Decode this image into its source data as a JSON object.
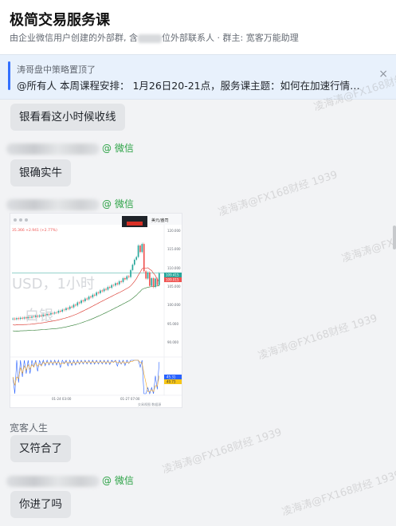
{
  "header": {
    "title": "极简交易服务课",
    "subtitle_prefix": "由企业微信用户创建的外部群, 含",
    "subtitle_suffix": "位外部联系人 · 群主: 宽客万能助理"
  },
  "pinned": {
    "title": "涛哥盘中策略置顶了",
    "content": "@所有人 本周课程安排： 1月26日20-21点，服务课主题：如何在加速行情中收...",
    "close": "×"
  },
  "messages": [
    {
      "text": "银看看这小时候收线"
    },
    {
      "sender_tag": "@ 微信",
      "text": "银确实牛"
    },
    {
      "sender_tag": "@ 微信"
    },
    {
      "sender": "宽客人生",
      "text": "又符合了"
    },
    {
      "sender_tag": "@ 微信",
      "text": "你进了吗"
    }
  ],
  "chart": {
    "price_change": "35.366 +2.941 (+2.77%)",
    "symbol_ghost": "USD，1小时",
    "name_ghost": "白银",
    "right_badge": "美元/盎司",
    "y_ticks": [
      "120.000",
      "115.000",
      "110.000",
      "105.000",
      "100.000",
      "95.000",
      "90.000"
    ],
    "last_price": "109.415",
    "last_price_sub": "109.015",
    "x_ticks": [
      "01-24 03:00",
      "01-27 07:00"
    ],
    "osc_labels": [
      "45.31",
      "49.73"
    ],
    "footer": "交易视图 数据源"
  },
  "chart_data": {
    "type": "line",
    "title": "",
    "close": [
      97.6,
      97.4,
      97.7,
      97.5,
      97.8,
      97.6,
      97.9,
      97.7,
      98.0,
      97.8,
      98.1,
      98.0,
      98.3,
      98.1,
      98.4,
      98.3,
      98.6,
      98.5,
      98.8,
      98.7,
      99.0,
      98.9,
      99.2,
      99.1,
      99.6,
      99.4,
      99.9,
      99.8,
      100.3,
      100.1,
      100.7,
      100.5,
      101.2,
      101.0,
      101.8,
      101.6,
      102.3,
      102.1,
      102.8,
      102.6,
      103.3,
      103.1,
      103.8,
      103.6,
      104.4,
      104.2,
      104.9,
      104.7,
      105.3,
      105.1,
      105.8,
      105.6,
      106.3,
      106.2,
      106.8,
      106.5,
      107.3,
      107.1,
      108.1,
      107.8,
      108.6,
      108.4,
      110.2,
      111.6,
      112.9,
      113.6,
      116.6,
      114.9,
      117.0,
      109.9,
      108.0,
      109.6,
      106.1,
      108.1,
      105.8,
      108.0,
      106.3,
      109.4
    ],
    "ylim": [
      88,
      122
    ]
  },
  "colors": {
    "wechat_green": "#2ba245",
    "bubble": "#e3e5e8",
    "pinned_bg": "#e8f1fc",
    "accent_blue": "#3370ff",
    "candle_up": "#26a69a",
    "candle_down": "#ef5350"
  },
  "watermarks": [
    "凌海涛@FX168财经 1939"
  ],
  "icons": {
    "close": "close-icon"
  }
}
